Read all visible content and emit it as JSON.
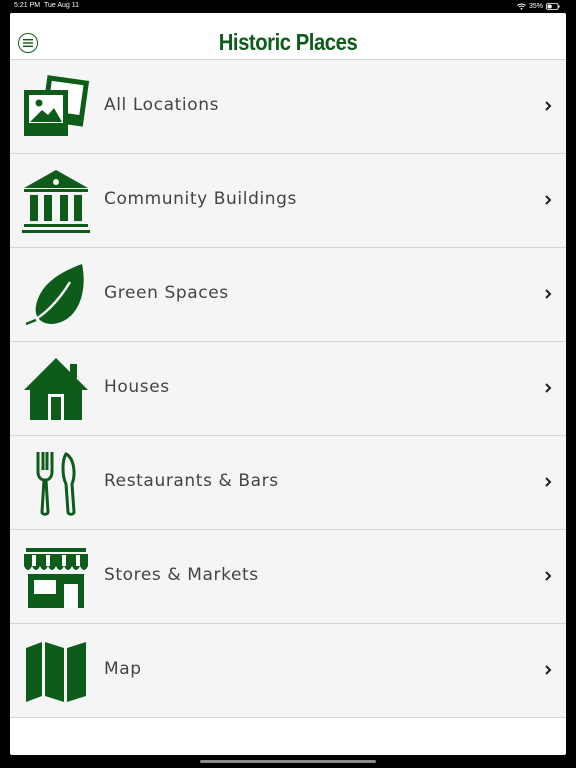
{
  "status_bar": {
    "time": "5:21 PM",
    "date": "Tue Aug 11",
    "battery": "35%"
  },
  "header": {
    "title": "Historic Places",
    "menu_icon": "menu-circle-icon"
  },
  "theme": {
    "accent": "#0d5c1a",
    "row_bg": "#f5f5f5",
    "text": "#444444"
  },
  "categories": [
    {
      "label": "All Locations",
      "icon": "photos-icon"
    },
    {
      "label": "Community Buildings",
      "icon": "bank-building-icon"
    },
    {
      "label": "Green Spaces",
      "icon": "leaf-icon"
    },
    {
      "label": "Houses",
      "icon": "house-icon"
    },
    {
      "label": "Restaurants & Bars",
      "icon": "fork-knife-icon"
    },
    {
      "label": "Stores & Markets",
      "icon": "storefront-icon"
    },
    {
      "label": "Map",
      "icon": "map-icon"
    }
  ]
}
